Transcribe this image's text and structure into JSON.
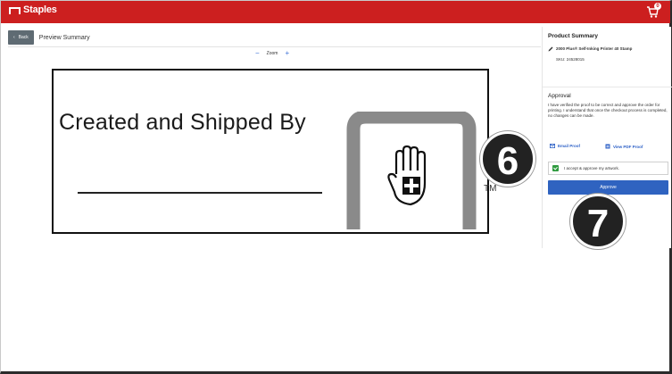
{
  "header": {
    "brand": "Staples",
    "cart_count": "0"
  },
  "toolbar": {
    "back_label": "Back",
    "title": "Preview Summary",
    "zoom_label": "Zoom",
    "zoom_minus": "−",
    "zoom_plus": "+"
  },
  "proof": {
    "stamp_text": "Created and Shipped By",
    "trademark": "TM"
  },
  "summary": {
    "heading": "Product Summary",
    "product_name": "2000 Plus® Self-Inking Printer 40 Stamp",
    "sku": "SKU: 24528015"
  },
  "approval": {
    "heading": "Approval",
    "body": "I have verified the proof to be correct and approve the order for printing. I understand that once the checkout process is completed, no changes can be made.",
    "email_proof": "Email Proof",
    "view_pdf": "View PDF Proof",
    "checkbox_label": "I accept & approve my artwork.",
    "approve_button": "Approve"
  },
  "annotations": {
    "step_a": "6",
    "step_b": "7"
  },
  "colors": {
    "brand_red": "#cc1f1f",
    "approve_blue": "#2f63c0",
    "link_blue": "#2f62c7",
    "check_green": "#2e9a3e",
    "logo_gray": "#8a8a8a"
  }
}
